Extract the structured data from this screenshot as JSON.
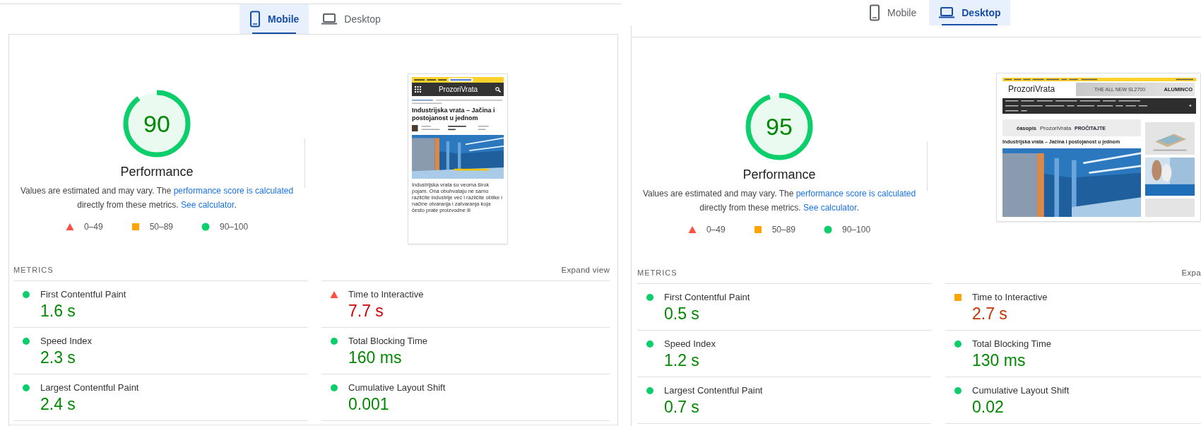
{
  "panels": [
    {
      "tabs": [
        {
          "label": "Mobile",
          "selected": true
        },
        {
          "label": "Desktop",
          "selected": false
        }
      ],
      "gauge": {
        "score": "90",
        "level": 0.9
      },
      "category": "Performance",
      "description": {
        "before": "Values are estimated and may vary. The ",
        "link": "performance score is calculated",
        "middle": " directly from these metrics. ",
        "link2": "See calculator",
        "after": "."
      },
      "legend": [
        {
          "kind": "triangle",
          "label": "0–49"
        },
        {
          "kind": "square",
          "label": "50–89"
        },
        {
          "kind": "circle",
          "label": "90–100"
        }
      ],
      "thumbnail": {
        "kind": "mobile",
        "logo": "ProzoriVrata",
        "title": "Industrijska vrata – Jačina i postojanost u jednom",
        "body": "Industrijska vrata su veoma širok pojam. Ona obuhvataju ne samo različite industrije već i različite oblike i načine otvaranja i zatvaranja koja često prate proizvodne ili"
      },
      "metrics_title": "METRICS",
      "expand": "Expand view",
      "metrics": [
        {
          "name": "First Contentful Paint",
          "value": "1.6 s",
          "kind": "pass"
        },
        {
          "name": "Time to Interactive",
          "value": "7.7 s",
          "kind": "fail"
        },
        {
          "name": "Speed Index",
          "value": "2.3 s",
          "kind": "pass"
        },
        {
          "name": "Total Blocking Time",
          "value": "160 ms",
          "kind": "pass"
        },
        {
          "name": "Largest Contentful Paint",
          "value": "2.4 s",
          "kind": "pass"
        },
        {
          "name": "Cumulative Layout Shift",
          "value": "0.001",
          "kind": "pass"
        }
      ]
    },
    {
      "tabs": [
        {
          "label": "Mobile",
          "selected": false
        },
        {
          "label": "Desktop",
          "selected": true
        }
      ],
      "gauge": {
        "score": "95",
        "level": 0.95
      },
      "category": "Performance",
      "description": {
        "before": "Values are estimated and may vary. The ",
        "link": "performance score is calculated",
        "middle": " directly from these metrics. ",
        "link2": "See calculator",
        "after": "."
      },
      "legend": [
        {
          "kind": "triangle",
          "label": "0–49"
        },
        {
          "kind": "square",
          "label": "50–89"
        },
        {
          "kind": "circle",
          "label": "90–100"
        }
      ],
      "thumbnail": {
        "kind": "desktop",
        "logo": "ProzoriVrata",
        "ad_headline": "THE ALL NEW SL2700",
        "ad_brand": "ALUMINCO",
        "promo_small": "časopis",
        "promo_logo": "ProzoriVrata",
        "promo_cta": "PROČITAJTE",
        "title": "Industrijska vrata – Jačina i postojanost u jednom"
      },
      "metrics_title": "METRICS",
      "expand": "Expa",
      "metrics": [
        {
          "name": "First Contentful Paint",
          "value": "0.5 s",
          "kind": "pass"
        },
        {
          "name": "Time to Interactive",
          "value": "2.7 s",
          "kind": "average"
        },
        {
          "name": "Speed Index",
          "value": "1.2 s",
          "kind": "pass"
        },
        {
          "name": "Total Blocking Time",
          "value": "130 ms",
          "kind": "pass"
        },
        {
          "name": "Largest Contentful Paint",
          "value": "0.7 s",
          "kind": "pass"
        },
        {
          "name": "Cumulative Layout Shift",
          "value": "0.02",
          "kind": "pass"
        }
      ]
    }
  ]
}
